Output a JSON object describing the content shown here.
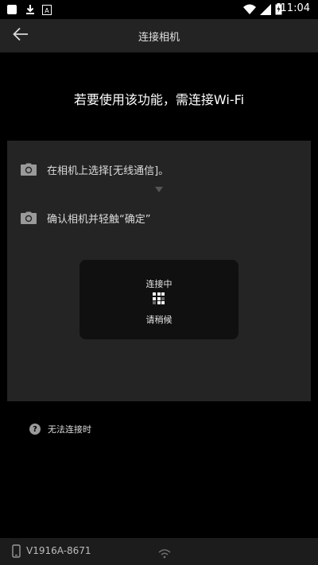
{
  "status_bar": {
    "time": "11:04",
    "icons": [
      "notification-square-icon",
      "download-icon",
      "app-a-icon",
      "wifi-icon",
      "signal-icon",
      "battery-charging-icon"
    ]
  },
  "header": {
    "title": "连接相机",
    "back_icon": "arrow-left-icon"
  },
  "headline": "若要使用该功能，需连接Wi-Fi",
  "steps": [
    {
      "icon": "camera-icon",
      "text": "在相机上选择[无线通信]。"
    },
    {
      "icon": "camera-icon",
      "text": "确认相机并轻触“确定”"
    }
  ],
  "progress_dialog": {
    "title": "连接中",
    "subtitle": "请稍候",
    "icon": "loading-grid-icon"
  },
  "help": {
    "icon": "question-circle-icon",
    "text": "无法连接时"
  },
  "bottom_bar": {
    "device_icon": "phone-icon",
    "device_name": "V1916A-8671",
    "wifi_icon": "wifi-icon"
  },
  "colors": {
    "background": "#000000",
    "header": "#232323",
    "panel": "#242424",
    "dialog": "#101010"
  }
}
